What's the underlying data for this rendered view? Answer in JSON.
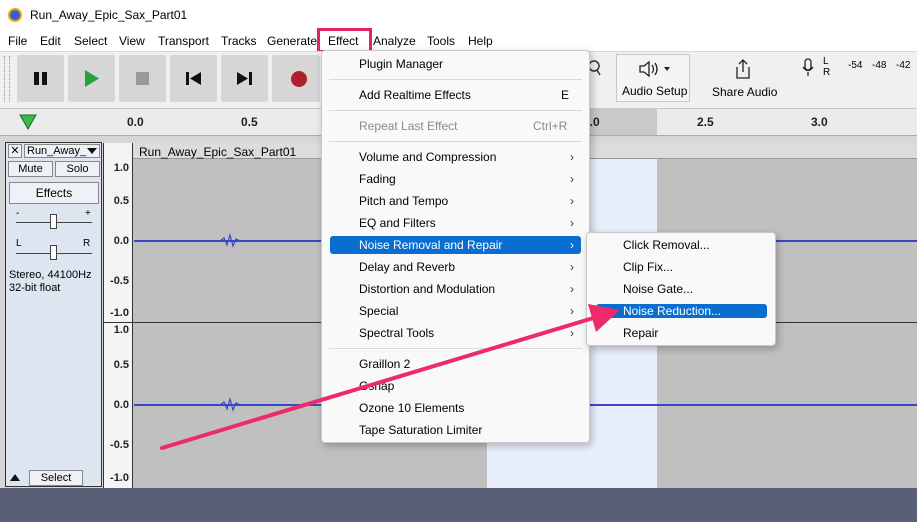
{
  "window": {
    "title": "Run_Away_Epic_Sax_Part01"
  },
  "menubar": {
    "file": "File",
    "edit": "Edit",
    "select": "Select",
    "view": "View",
    "transport": "Transport",
    "tracks": "Tracks",
    "generate": "Generate",
    "effect": "Effect",
    "analyze": "Analyze",
    "tools": "Tools",
    "help": "Help"
  },
  "toolbar": {
    "pause_icon": "pause-icon",
    "play_icon": "play-icon",
    "stop_icon": "stop-icon",
    "skip_start_icon": "skip-to-start-icon",
    "skip_end_icon": "skip-to-end-icon",
    "record_icon": "record-icon",
    "audio_setup_label": "Audio Setup",
    "share_audio_label": "Share Audio",
    "meter_l": "L",
    "meter_r": "R",
    "meter_ticks": [
      "-54",
      "-48",
      "-42"
    ]
  },
  "ruler": {
    "ticks": [
      "0.0",
      "0.5",
      "2.0",
      "2.5",
      "3.0"
    ]
  },
  "track": {
    "name": "Run_Away_",
    "clip_name": "Run_Away_Epic_Sax_Part01",
    "mute_label": "Mute",
    "solo_label": "Solo",
    "effects_label": "Effects",
    "gain_minus": "-",
    "gain_plus": "+",
    "pan_l": "L",
    "pan_r": "R",
    "info_line1": "Stereo, 44100Hz",
    "info_line2": "32-bit float",
    "select_label": "Select"
  },
  "vscale": {
    "labels": [
      "1.0",
      "0.5",
      "0.0",
      "-0.5",
      "-1.0"
    ]
  },
  "effect_menu": {
    "items": [
      {
        "label": "Plugin Manager",
        "shortcut": ""
      },
      {
        "label": "Add Realtime Effects",
        "shortcut": "E"
      },
      {
        "label": "Repeat Last Effect",
        "shortcut": "Ctrl+R"
      },
      {
        "label": "Volume and Compression",
        "shortcut": "›"
      },
      {
        "label": "Fading",
        "shortcut": "›"
      },
      {
        "label": "Pitch and Tempo",
        "shortcut": "›"
      },
      {
        "label": "EQ and Filters",
        "shortcut": "›"
      },
      {
        "label": "Noise Removal and Repair",
        "shortcut": "›"
      },
      {
        "label": "Delay and Reverb",
        "shortcut": "›"
      },
      {
        "label": "Distortion and Modulation",
        "shortcut": "›"
      },
      {
        "label": "Special",
        "shortcut": "›"
      },
      {
        "label": "Spectral Tools",
        "shortcut": "›"
      },
      {
        "label": "Graillon 2",
        "shortcut": ""
      },
      {
        "label": "Ozone 10 Elements",
        "shortcut": ""
      },
      {
        "label": "Tape Saturation Limiter",
        "shortcut": ""
      }
    ],
    "partial_label": "Gsnap"
  },
  "noise_submenu": {
    "items": [
      "Click Removal...",
      "Clip Fix...",
      "Noise Gate...",
      "Noise Reduction...",
      "Repair"
    ]
  },
  "colors": {
    "accent": "#0a6ed1",
    "highlight_box": "#e0246a",
    "arrow": "#ec2a6c",
    "waveform": "#3a46c8"
  }
}
